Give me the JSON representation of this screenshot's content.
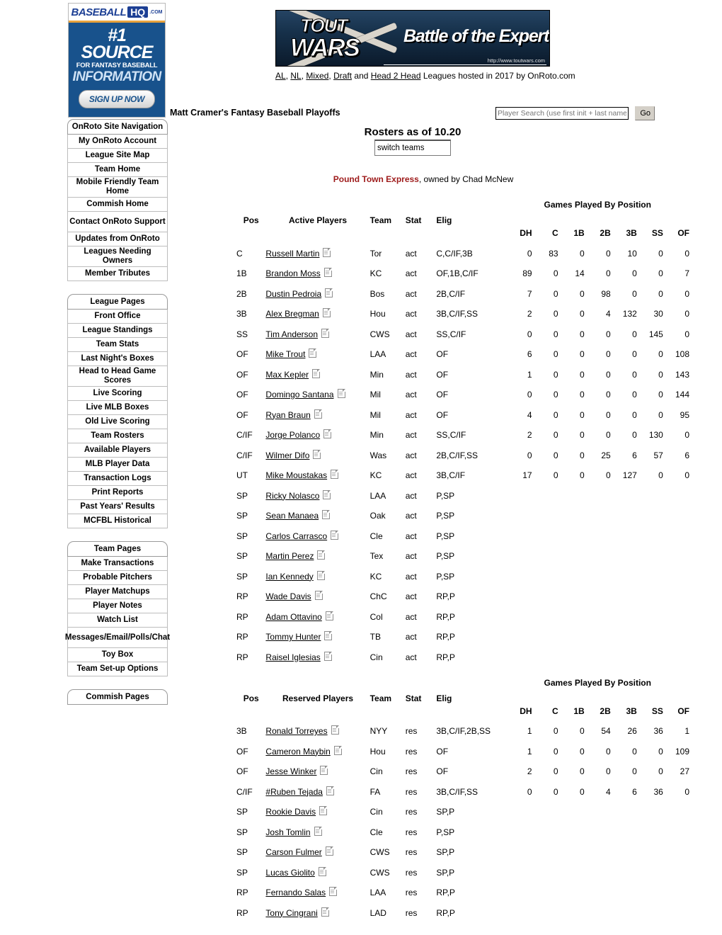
{
  "ads": {
    "baseballhq": {
      "brand": "BASEBALL",
      "badge": "HQ",
      "com": ".COM",
      "line1": "#1 SOURCE",
      "line2": "FOR FANTASY BASEBALL",
      "line3": "INFORMATION",
      "cta": "SIGN UP NOW"
    },
    "toutwars": {
      "word1": "TOUT",
      "word2": "WARS",
      "tagline": "Battle of the Experts",
      "url": "http://www.toutwars.com",
      "subline_links": [
        "AL",
        "NL",
        "Mixed",
        "Draft",
        "Head 2 Head"
      ],
      "subline_text_a": ", ",
      "subline_tail": "Leagues hosted in 2017 by OnRoto.com",
      "subline_full": "AL, NL, Mixed, Draft and Head 2 Head Leagues hosted in 2017 by OnRoto.com"
    }
  },
  "header": {
    "page_title": "Matt Cramer's Fantasy Baseball Playoffs"
  },
  "search": {
    "placeholder": "Player Search (use first init + last name)",
    "value": "",
    "go_label": "Go"
  },
  "main": {
    "rosters_title": "Rosters as of 10.20",
    "switch_teams_placeholder": "switch teams",
    "switch_teams_value": "switch teams",
    "team_name": "Pound Town Express",
    "team_owner_text": ", owned by Chad McNew"
  },
  "sidebar": {
    "groups": [
      {
        "header": "OnRoto Site Navigation",
        "items": [
          "My OnRoto Account",
          "League Site Map",
          "Team Home",
          "Mobile Friendly Team Home",
          "Commish Home",
          "Contact OnRoto Support",
          "Updates from OnRoto",
          "Leagues Needing Owners",
          "Member Tributes"
        ]
      },
      {
        "header": "League Pages",
        "items": [
          "Front Office",
          "League Standings",
          "Team Stats",
          "Last Night's Boxes",
          "Head to Head Game Scores",
          "Live Scoring",
          "Live MLB Boxes",
          "Old Live Scoring",
          "Team Rosters",
          "Available Players",
          "MLB Player Data",
          "Transaction Logs",
          "Print Reports",
          "Past Years' Results",
          "MCFBL Historical"
        ]
      },
      {
        "header": "Team Pages",
        "items": [
          "Make Transactions",
          "Probable Pitchers",
          "Player Matchups",
          "Player Notes",
          "Watch List",
          "Messages/Email/Polls/Chat",
          "Toy Box",
          "Team Set-up Options"
        ]
      },
      {
        "header": "Commish Pages",
        "items": []
      }
    ]
  },
  "tables": {
    "gpp_header": "Games Played By Position",
    "gpp_columns": [
      "DH",
      "C",
      "1B",
      "2B",
      "3B",
      "SS",
      "OF"
    ],
    "active": {
      "columns": [
        "Pos",
        "Active Players",
        "Team",
        "Stat",
        "Elig"
      ],
      "rows": [
        {
          "pos": "C",
          "name": "Russell Martin",
          "team": "Tor",
          "stat": "act",
          "elig": "C,C/IF,3B",
          "gp": [
            "0",
            "83",
            "0",
            "0",
            "10",
            "0",
            "0"
          ]
        },
        {
          "pos": "1B",
          "name": "Brandon Moss",
          "team": "KC",
          "stat": "act",
          "elig": "OF,1B,C/IF",
          "gp": [
            "89",
            "0",
            "14",
            "0",
            "0",
            "0",
            "7"
          ]
        },
        {
          "pos": "2B",
          "name": "Dustin Pedroia",
          "team": "Bos",
          "stat": "act",
          "elig": "2B,C/IF",
          "gp": [
            "7",
            "0",
            "0",
            "98",
            "0",
            "0",
            "0"
          ]
        },
        {
          "pos": "3B",
          "name": "Alex Bregman",
          "team": "Hou",
          "stat": "act",
          "elig": "3B,C/IF,SS",
          "gp": [
            "2",
            "0",
            "0",
            "4",
            "132",
            "30",
            "0"
          ]
        },
        {
          "pos": "SS",
          "name": "Tim Anderson",
          "team": "CWS",
          "stat": "act",
          "elig": "SS,C/IF",
          "gp": [
            "0",
            "0",
            "0",
            "0",
            "0",
            "145",
            "0"
          ]
        },
        {
          "pos": "OF",
          "name": "Mike Trout",
          "team": "LAA",
          "stat": "act",
          "elig": "OF",
          "gp": [
            "6",
            "0",
            "0",
            "0",
            "0",
            "0",
            "108"
          ]
        },
        {
          "pos": "OF",
          "name": "Max Kepler",
          "team": "Min",
          "stat": "act",
          "elig": "OF",
          "gp": [
            "1",
            "0",
            "0",
            "0",
            "0",
            "0",
            "143"
          ]
        },
        {
          "pos": "OF",
          "name": "Domingo Santana",
          "team": "Mil",
          "stat": "act",
          "elig": "OF",
          "gp": [
            "0",
            "0",
            "0",
            "0",
            "0",
            "0",
            "144"
          ]
        },
        {
          "pos": "OF",
          "name": "Ryan Braun",
          "team": "Mil",
          "stat": "act",
          "elig": "OF",
          "gp": [
            "4",
            "0",
            "0",
            "0",
            "0",
            "0",
            "95"
          ]
        },
        {
          "pos": "C/IF",
          "name": "Jorge Polanco",
          "team": "Min",
          "stat": "act",
          "elig": "SS,C/IF",
          "gp": [
            "2",
            "0",
            "0",
            "0",
            "0",
            "130",
            "0"
          ]
        },
        {
          "pos": "C/IF",
          "name": "Wilmer Difo",
          "team": "Was",
          "stat": "act",
          "elig": "2B,C/IF,SS",
          "gp": [
            "0",
            "0",
            "0",
            "25",
            "6",
            "57",
            "6"
          ]
        },
        {
          "pos": "UT",
          "name": "Mike Moustakas",
          "team": "KC",
          "stat": "act",
          "elig": "3B,C/IF",
          "gp": [
            "17",
            "0",
            "0",
            "0",
            "127",
            "0",
            "0"
          ]
        },
        {
          "pos": "SP",
          "name": "Ricky Nolasco",
          "team": "LAA",
          "stat": "act",
          "elig": "P,SP",
          "gp": [
            "",
            "",
            "",
            "",
            "",
            "",
            ""
          ]
        },
        {
          "pos": "SP",
          "name": "Sean Manaea",
          "team": "Oak",
          "stat": "act",
          "elig": "P,SP",
          "gp": [
            "",
            "",
            "",
            "",
            "",
            "",
            ""
          ]
        },
        {
          "pos": "SP",
          "name": "Carlos Carrasco",
          "team": "Cle",
          "stat": "act",
          "elig": "P,SP",
          "gp": [
            "",
            "",
            "",
            "",
            "",
            "",
            ""
          ]
        },
        {
          "pos": "SP",
          "name": "Martin Perez",
          "team": "Tex",
          "stat": "act",
          "elig": "P,SP",
          "gp": [
            "",
            "",
            "",
            "",
            "",
            "",
            ""
          ]
        },
        {
          "pos": "SP",
          "name": "Ian Kennedy",
          "team": "KC",
          "stat": "act",
          "elig": "P,SP",
          "gp": [
            "",
            "",
            "",
            "",
            "",
            "",
            ""
          ]
        },
        {
          "pos": "RP",
          "name": "Wade Davis",
          "team": "ChC",
          "stat": "act",
          "elig": "RP,P",
          "gp": [
            "",
            "",
            "",
            "",
            "",
            "",
            ""
          ]
        },
        {
          "pos": "RP",
          "name": "Adam Ottavino",
          "team": "Col",
          "stat": "act",
          "elig": "RP,P",
          "gp": [
            "",
            "",
            "",
            "",
            "",
            "",
            ""
          ]
        },
        {
          "pos": "RP",
          "name": "Tommy Hunter",
          "team": "TB",
          "stat": "act",
          "elig": "RP,P",
          "gp": [
            "",
            "",
            "",
            "",
            "",
            "",
            ""
          ]
        },
        {
          "pos": "RP",
          "name": "Raisel Iglesias",
          "team": "Cin",
          "stat": "act",
          "elig": "RP,P",
          "gp": [
            "",
            "",
            "",
            "",
            "",
            "",
            ""
          ]
        }
      ]
    },
    "reserved": {
      "columns": [
        "Pos",
        "Reserved Players",
        "Team",
        "Stat",
        "Elig"
      ],
      "rows": [
        {
          "pos": "3B",
          "name": "Ronald Torreyes",
          "team": "NYY",
          "stat": "res",
          "elig": "3B,C/IF,2B,SS",
          "gp": [
            "1",
            "0",
            "0",
            "54",
            "26",
            "36",
            "1"
          ]
        },
        {
          "pos": "OF",
          "name": "Cameron Maybin",
          "team": "Hou",
          "stat": "res",
          "elig": "OF",
          "gp": [
            "1",
            "0",
            "0",
            "0",
            "0",
            "0",
            "109"
          ]
        },
        {
          "pos": "OF",
          "name": "Jesse Winker",
          "team": "Cin",
          "stat": "res",
          "elig": "OF",
          "gp": [
            "2",
            "0",
            "0",
            "0",
            "0",
            "0",
            "27"
          ]
        },
        {
          "pos": "C/IF",
          "name": "#Ruben Tejada",
          "team": "FA",
          "stat": "res",
          "elig": "3B,C/IF,SS",
          "gp": [
            "0",
            "0",
            "0",
            "4",
            "6",
            "36",
            "0"
          ]
        },
        {
          "pos": "SP",
          "name": "Rookie Davis",
          "team": "Cin",
          "stat": "res",
          "elig": "SP,P",
          "gp": [
            "",
            "",
            "",
            "",
            "",
            "",
            ""
          ]
        },
        {
          "pos": "SP",
          "name": "Josh Tomlin",
          "team": "Cle",
          "stat": "res",
          "elig": "P,SP",
          "gp": [
            "",
            "",
            "",
            "",
            "",
            "",
            ""
          ]
        },
        {
          "pos": "SP",
          "name": "Carson Fulmer",
          "team": "CWS",
          "stat": "res",
          "elig": "SP,P",
          "gp": [
            "",
            "",
            "",
            "",
            "",
            "",
            ""
          ]
        },
        {
          "pos": "SP",
          "name": "Lucas Giolito",
          "team": "CWS",
          "stat": "res",
          "elig": "SP,P",
          "gp": [
            "",
            "",
            "",
            "",
            "",
            "",
            ""
          ]
        },
        {
          "pos": "RP",
          "name": "Fernando Salas",
          "team": "LAA",
          "stat": "res",
          "elig": "RP,P",
          "gp": [
            "",
            "",
            "",
            "",
            "",
            "",
            ""
          ]
        },
        {
          "pos": "RP",
          "name": "Tony Cingrani",
          "team": "LAD",
          "stat": "res",
          "elig": "RP,P",
          "gp": [
            "",
            "",
            "",
            "",
            "",
            "",
            ""
          ]
        }
      ]
    }
  },
  "colors": {
    "team_name": "#9e1b1b",
    "bhq_blue": "#18528c",
    "bhq_orange": "#e8a33d"
  }
}
